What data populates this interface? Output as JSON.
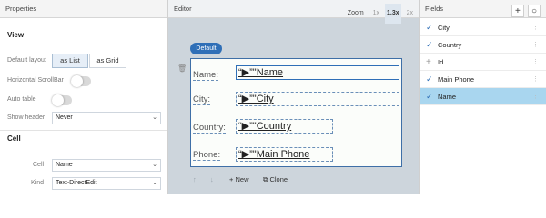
{
  "properties": {
    "title": "Properties",
    "view_section": "View",
    "default_layout_label": "Default layout",
    "layout_list": "as List",
    "layout_grid": "as Grid",
    "horizontal_scrollbar_label": "Horizontal ScrollBar",
    "auto_table_label": "Auto table",
    "show_header_label": "Show header",
    "show_header_value": "Never",
    "cell_section": "Cell",
    "cell_label": "Cell",
    "cell_value": "Name",
    "kind_label": "Kind",
    "kind_value": "Text-DirectEdit"
  },
  "editor": {
    "title": "Editor",
    "zoom_label": "Zoom",
    "zoom_options": [
      "1x",
      "1.3x",
      "2x"
    ],
    "zoom_selected": "1.3x",
    "default_badge": "Default",
    "rows": [
      {
        "label": "Name:",
        "value": "“▶”\"Name"
      },
      {
        "label": "City:",
        "value": "“▶”\"City"
      },
      {
        "label": "Country:",
        "value": "“▶”\"Country"
      },
      {
        "label": "Phone:",
        "value": "“▶”\"Main Phone"
      }
    ],
    "new_label": "New",
    "clone_label": "Clone"
  },
  "fields": {
    "title": "Fields",
    "items": [
      {
        "name": "City",
        "checked": true
      },
      {
        "name": "Country",
        "checked": true
      },
      {
        "name": "Id",
        "checked": false
      },
      {
        "name": "Main Phone",
        "checked": true
      },
      {
        "name": "Name",
        "checked": true,
        "selected": true
      }
    ]
  },
  "colors": {
    "accent": "#2f6fb7",
    "selected_row": "#a9d6ef",
    "editor_bg": "#cdd5dc"
  }
}
